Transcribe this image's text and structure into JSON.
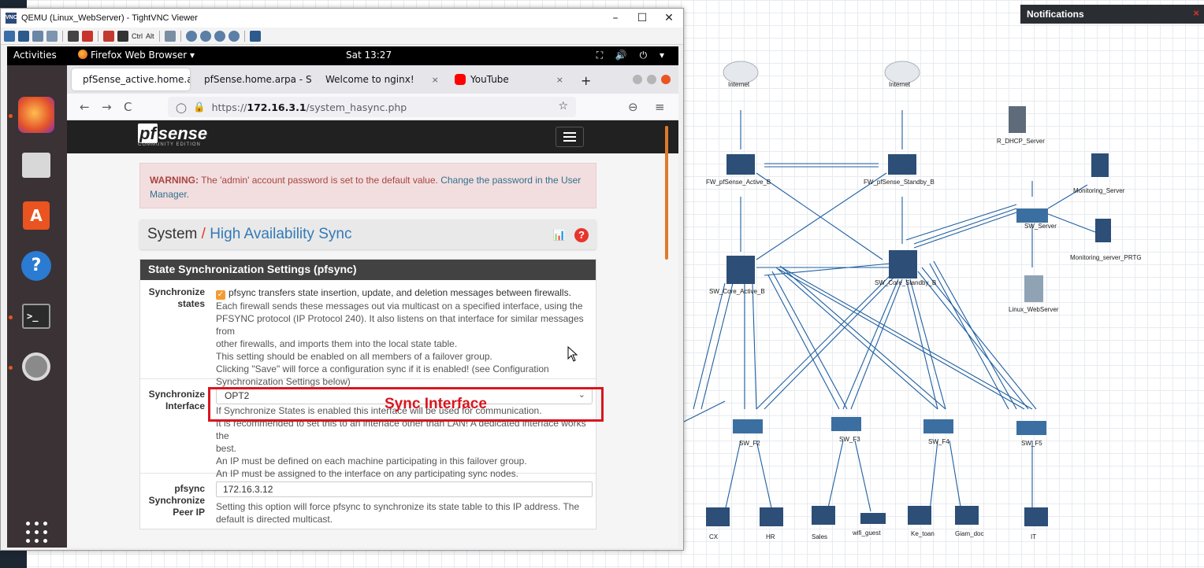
{
  "notifications": {
    "title": "Notifications",
    "close": "×"
  },
  "vnc": {
    "title": "QEMU (Linux_WebServer) - TightVNC Viewer",
    "toolbar_text": {
      "ctrl": "Ctrl",
      "alt": "Alt"
    },
    "window_controls": {
      "minimize": "–",
      "maximize": "☐",
      "close": "✕"
    }
  },
  "gnome": {
    "activities": "Activities",
    "app_menu": "Firefox Web Browser ▾",
    "clock": "Sat 13:27",
    "tray": "⛶ 🔊 ⏻ ▾"
  },
  "firefox": {
    "tabs": [
      {
        "label": "pfSense_active.home.a",
        "close": "×",
        "active": true
      },
      {
        "label": "pfSense.home.arpa - S",
        "close": "×",
        "active": false
      },
      {
        "label": "Welcome to nginx!",
        "close": "×",
        "active": false
      },
      {
        "label": "YouTube",
        "close": "×",
        "active": false
      }
    ],
    "new_tab": "+",
    "url_prefix": "https://",
    "url_host": "172.16.3.1",
    "url_path": "/system_hasync.php",
    "nav": {
      "back": "←",
      "forward": "→",
      "reload": "C",
      "shield": "◯",
      "lock": "🔒",
      "star": "☆",
      "pocket": "⊖",
      "menu": "≡"
    }
  },
  "pfsense": {
    "logo_pf": "pf",
    "logo_text": "sense",
    "logo_sub": "COMMUNITY EDITION",
    "warning_bold": "WARNING:",
    "warning_text": " The 'admin' account password is set to the default value. ",
    "warning_link": "Change the password in the User Manager.",
    "breadcrumb_root": "System",
    "breadcrumb_sep": "/",
    "breadcrumb_page": "High Availability Sync",
    "chart_icon": "📊",
    "help_icon": "?",
    "section_title": "State Synchronization Settings (pfsync)",
    "rows": {
      "sync_states": {
        "label": "Synchronize states",
        "checkbox": "✓",
        "main": "pfsync transfers state insertion, update, and deletion messages between firewalls.",
        "help": [
          "Each firewall sends these messages out via multicast on a specified interface, using the",
          "PFSYNC protocol (IP Protocol 240). It also listens on that interface for similar messages from",
          "other firewalls, and imports them into the local state table.",
          "This setting should be enabled on all members of a failover group.",
          "Clicking \"Save\" will force a configuration sync if it is enabled! (see Configuration",
          "Synchronization Settings below)"
        ]
      },
      "sync_iface": {
        "label": "Synchronize Interface",
        "value": "OPT2",
        "arrow": "⌄",
        "help": [
          "If Synchronize States is enabled this interface will be used for communication.",
          "It is recommended to set this to an interface other than LAN! A dedicated interface works the",
          "best.",
          "An IP must be defined on each machine participating in this failover group.",
          "An IP must be assigned to the interface on any participating sync nodes."
        ]
      },
      "peer_ip": {
        "label": "pfsync Synchronize Peer IP",
        "value": "172.16.3.12",
        "help": [
          "Setting this option will force pfsync to synchronize its state table to this IP address. The",
          "default is directed multicast."
        ]
      }
    }
  },
  "annotation": {
    "text": "Sync Interface",
    "color": "#d8161f"
  },
  "topology": {
    "nodes": {
      "internet1": "Internet",
      "internet2": "Internet",
      "fw_active": "FW_pfSense_Active_B",
      "fw_standby": "FW_pfSense_Standby_B",
      "r_dhcp": "R_DHCP_Server",
      "monitoring": "Monitoring_Server",
      "monitoring_prtg": "Monitoring_server_PRTG",
      "sw_server": "SW_Server",
      "linux_web": "Linux_WebServer",
      "sw_core_active": "SW_Core_Active_B",
      "sw_core_standby": "SW_Core_Standby_B",
      "sw_f2": "SW_F2",
      "sw_f3": "SW_F3",
      "sw_f4": "SW_F4",
      "sw_f5": "SW_F5",
      "pc_cx": "CX",
      "pc_hr": "HR",
      "pc_sales": "Sales",
      "wifi_guest": "wifi_guest",
      "pc_ke_toan": "Ke_toan",
      "pc_giam_doc": "Giam_doc",
      "pc_it": "IT"
    }
  },
  "colors": {
    "eve_link": "#1f5fa0",
    "pf_dark": "#212121",
    "pf_red": "#e8352c",
    "pf_blue": "#337ab7",
    "ubuntu_orange": "#e95420"
  }
}
